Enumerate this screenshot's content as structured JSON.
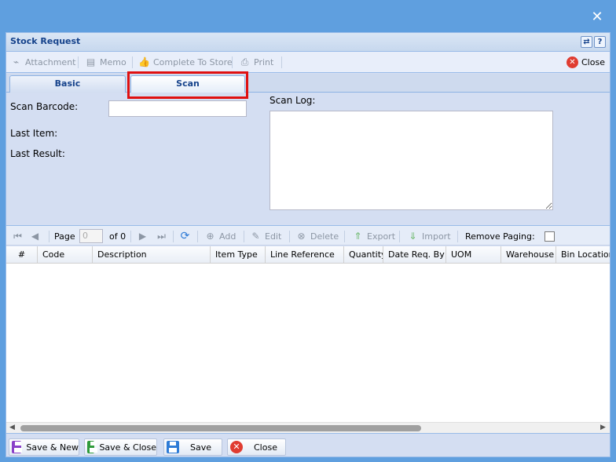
{
  "dialog": {
    "close_glyph": "✕"
  },
  "window": {
    "title": "Stock Request",
    "refresh_glyph": "⇄",
    "help_glyph": "?"
  },
  "toolbar": {
    "attachment": "Attachment",
    "memo": "Memo",
    "complete": "Complete To Store",
    "print": "Print",
    "close": "Close"
  },
  "tabs": {
    "basic": "Basic",
    "scan": "Scan"
  },
  "scan": {
    "barcode_label": "Scan Barcode:",
    "barcode_value": "",
    "last_item_label": "Last Item:",
    "last_result_label": "Last Result:",
    "log_label": "Scan Log:"
  },
  "grid_toolbar": {
    "page_label": "Page",
    "page_value": "0",
    "of_label": "of 0",
    "add": "Add",
    "edit": "Edit",
    "delete": "Delete",
    "export": "Export",
    "import": "Import",
    "remove_paging": "Remove Paging:"
  },
  "grid": {
    "columns": [
      "#",
      "Code",
      "Description",
      "Item Type",
      "Line Reference",
      "Quantity",
      "Date Req. By",
      "UOM",
      "Warehouse",
      "Bin Location"
    ]
  },
  "buttons": {
    "save_new": "Save & New",
    "save_close": "Save & Close",
    "save": "Save",
    "close": "Close"
  },
  "colors": {
    "accent": "#15428b",
    "highlight": "#e01010",
    "window_bg": "#d4def2"
  },
  "icons": {
    "close": "close-icon",
    "attachment": "paperclip-icon",
    "memo": "memo-icon",
    "complete": "thumbs-up-icon",
    "print": "printer-icon"
  }
}
